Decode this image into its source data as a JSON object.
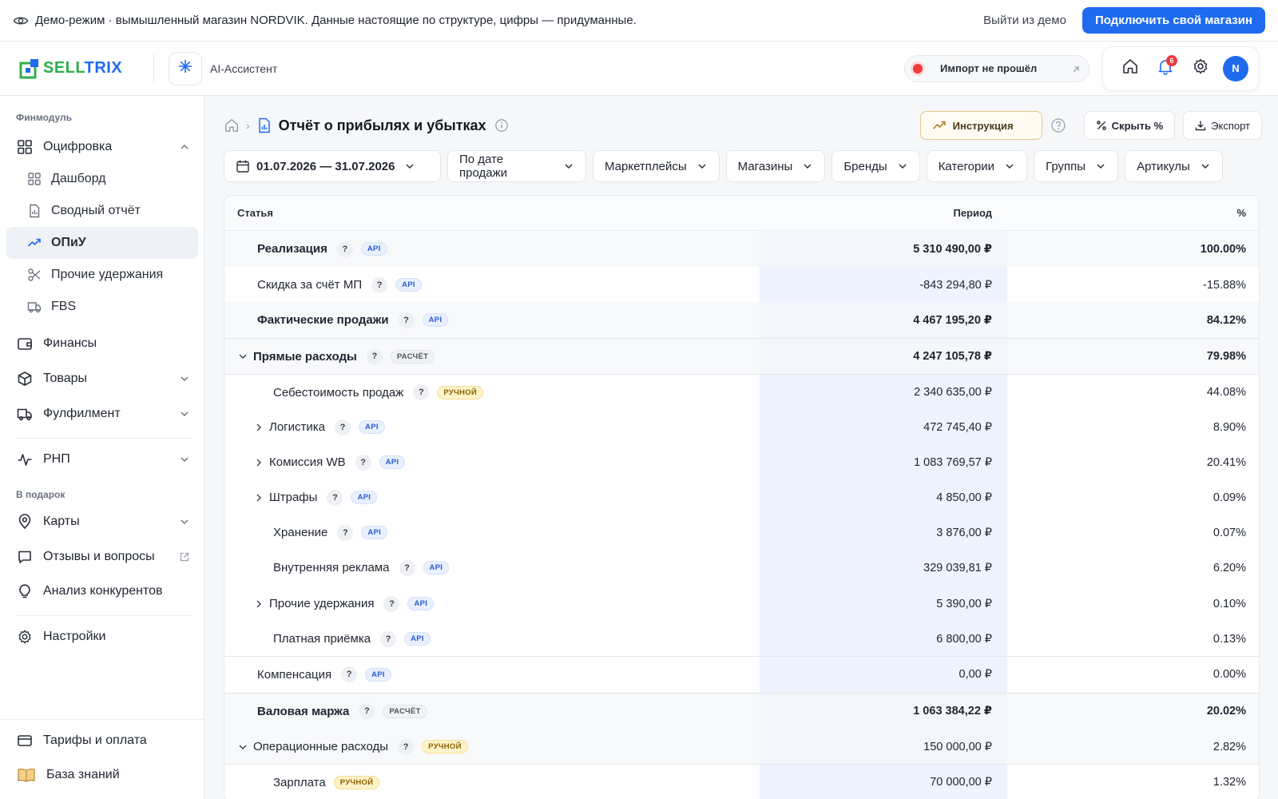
{
  "banner": {
    "text": "Демо-режим · вымышленный магазин NORDVIK. Данные настоящие по структуре, цифры — придуманные.",
    "exit_label": "Выйти из демо",
    "connect_label": "Подключить свой магазин"
  },
  "header": {
    "logo_text_a": "SELL",
    "logo_text_b": "TRIX",
    "ai_label": "AI-Ассистент",
    "import_status": "Импорт не прошёл",
    "notifications_count": "6",
    "avatar_letter": "N"
  },
  "sidebar": {
    "section_finmodule": "Финмодуль",
    "digitization": "Оцифровка",
    "dashboard": "Дашборд",
    "summary_report": "Сводный отчёт",
    "pnl": "ОПиУ",
    "other_deductions": "Прочие удержания",
    "fbs": "FBS",
    "finance": "Финансы",
    "goods": "Товары",
    "fulfillment": "Фулфилмент",
    "rnp": "РНП",
    "section_gift": "В подарок",
    "maps": "Карты",
    "reviews": "Отзывы и вопросы",
    "competitors": "Анализ конкурентов",
    "settings": "Настройки",
    "tariffs": "Тарифы и оплата",
    "knowledge": "База знаний"
  },
  "page": {
    "title": "Отчёт о прибылях и убытках",
    "instruction_label": "Инструкция",
    "hide_pct_label": "Скрыть %",
    "export_label": "Экспорт"
  },
  "filters": {
    "date_range": "01.07.2026 — 31.07.2026",
    "date_mode": "По дате продажи",
    "marketplaces": "Маркетплейсы",
    "shops": "Магазины",
    "brands": "Бренды",
    "categories": "Категории",
    "groups": "Группы",
    "articles": "Артикулы"
  },
  "table": {
    "col_item": "Статья",
    "col_period": "Период",
    "col_pct": "%",
    "rows": [
      {
        "name": "Реализация",
        "tag": "API",
        "value": "5 310 490,00 ₽",
        "pct": "100.00%"
      },
      {
        "name": "Скидка за счёт МП",
        "tag": "API",
        "value": "-843 294,80 ₽",
        "pct": "-15.88%"
      },
      {
        "name": "Фактические продажи",
        "tag": "API",
        "value": "4 467 195,20 ₽",
        "pct": "84.12%"
      },
      {
        "name": "Прямые расходы",
        "tag": "РАСЧЁТ",
        "value": "4 247 105,78 ₽",
        "pct": "79.98%"
      },
      {
        "name": "Себестоимость продаж",
        "tag": "РУЧНОЙ",
        "value": "2 340 635,00 ₽",
        "pct": "44.08%"
      },
      {
        "name": "Логистика",
        "tag": "API",
        "value": "472 745,40 ₽",
        "pct": "8.90%"
      },
      {
        "name": "Комиссия WB",
        "tag": "API",
        "value": "1 083 769,57 ₽",
        "pct": "20.41%"
      },
      {
        "name": "Штрафы",
        "tag": "API",
        "value": "4 850,00 ₽",
        "pct": "0.09%"
      },
      {
        "name": "Хранение",
        "tag": "API",
        "value": "3 876,00 ₽",
        "pct": "0.07%"
      },
      {
        "name": "Внутренняя реклама",
        "tag": "API",
        "value": "329 039,81 ₽",
        "pct": "6.20%"
      },
      {
        "name": "Прочие удержания",
        "tag": "API",
        "value": "5 390,00 ₽",
        "pct": "0.10%"
      },
      {
        "name": "Платная приёмка",
        "tag": "API",
        "value": "6 800,00 ₽",
        "pct": "0.13%"
      },
      {
        "name": "Компенсация",
        "tag": "API",
        "value": "0,00 ₽",
        "pct": "0.00%"
      },
      {
        "name": "Валовая маржа",
        "tag": "РАСЧЁТ",
        "value": "1 063 384,22 ₽",
        "pct": "20.02%"
      },
      {
        "name": "Операционные расходы",
        "tag": "РУЧНОЙ",
        "value": "150 000,00 ₽",
        "pct": "2.82%"
      },
      {
        "name": "Зарплата",
        "tag": "РУЧНОЙ",
        "value": "70 000,00 ₽",
        "pct": "1.32%"
      }
    ]
  }
}
